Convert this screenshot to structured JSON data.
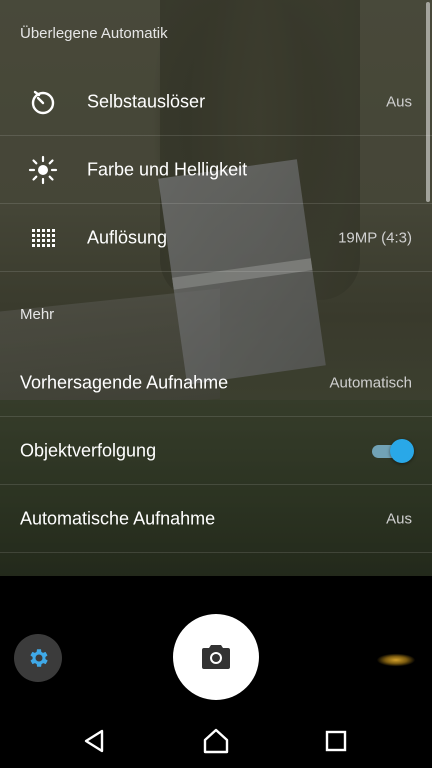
{
  "sections": {
    "main_title": "Überlegene Automatik",
    "more_title": "Mehr"
  },
  "rows": [
    {
      "label": "Selbstauslöser",
      "value": "Aus",
      "icon": "self-timer-icon"
    },
    {
      "label": "Farbe und Helligkeit",
      "value": "",
      "icon": "brightness-icon"
    },
    {
      "label": "Auflösung",
      "value": "19MP (4:3)",
      "icon": "resolution-grid-icon"
    }
  ],
  "more_rows": [
    {
      "label": "Vorhersagende Aufnahme",
      "value": "Automatisch"
    },
    {
      "label": "Objektverfolgung",
      "toggle_on": true
    },
    {
      "label": "Automatische Aufnahme",
      "value": "Aus"
    }
  ],
  "colors": {
    "accent": "#29a8e8",
    "settings_icon": "#3fa9e8"
  },
  "controls": {
    "settings_icon": "gear-icon",
    "shutter_icon": "camera-icon",
    "nav_back": "back-triangle-icon",
    "nav_home": "home-icon",
    "nav_recents": "recents-square-icon"
  }
}
